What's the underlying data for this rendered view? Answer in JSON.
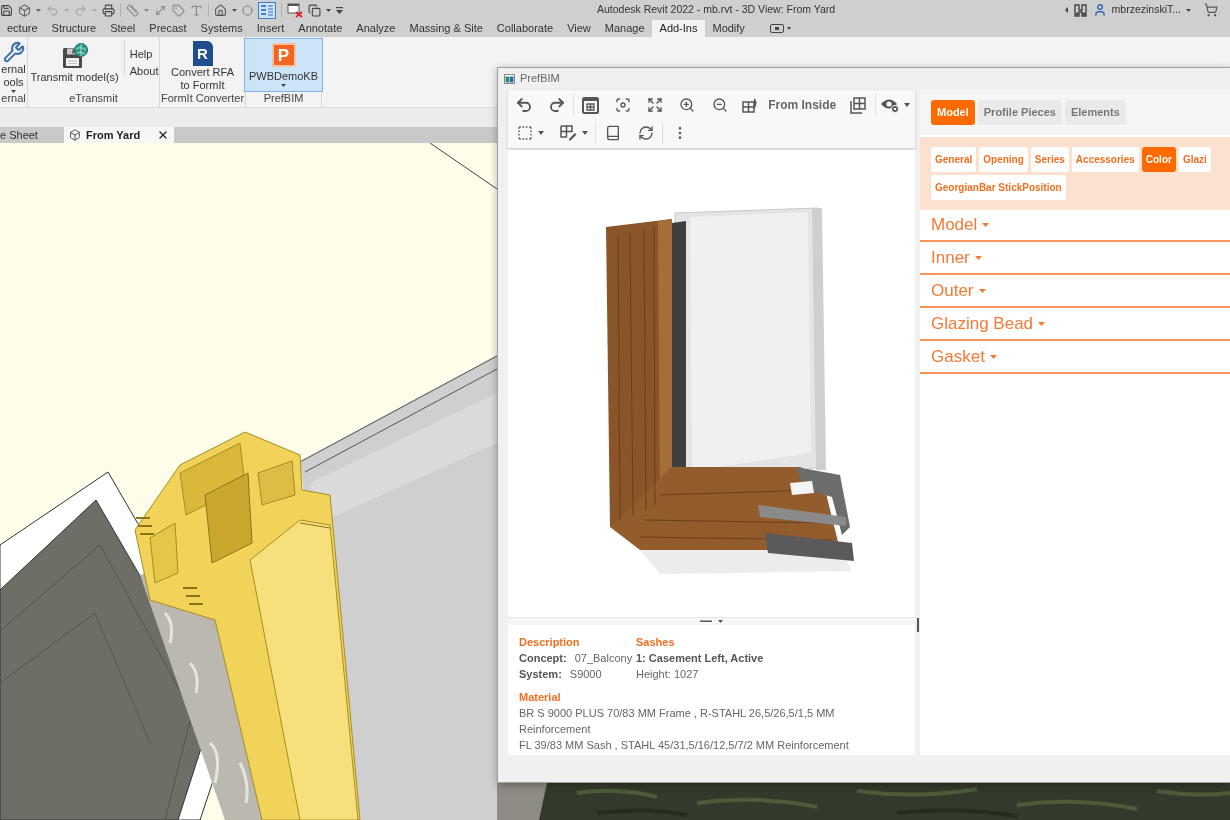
{
  "window": {
    "title": "Autodesk Revit 2022 - mb.rvt - 3D View: From Yard"
  },
  "quick_access_toolbar": {
    "undo": {
      "disabled": true
    },
    "redo": {
      "disabled": true
    },
    "thin_lines": {
      "on": true
    }
  },
  "account": {
    "user_name": "mbrzezinskiT..."
  },
  "ribbon_tabs": [
    {
      "label": "ecture",
      "selected": false
    },
    {
      "label": "Structure",
      "selected": false
    },
    {
      "label": "Steel",
      "selected": false
    },
    {
      "label": "Precast",
      "selected": false
    },
    {
      "label": "Systems",
      "selected": false
    },
    {
      "label": "Insert",
      "selected": false
    },
    {
      "label": "Annotate",
      "selected": false
    },
    {
      "label": "Analyze",
      "selected": false
    },
    {
      "label": "Massing & Site",
      "selected": false
    },
    {
      "label": "Collaborate",
      "selected": false
    },
    {
      "label": "View",
      "selected": false
    },
    {
      "label": "Manage",
      "selected": false
    },
    {
      "label": "Add-Ins",
      "selected": true
    },
    {
      "label": "Modify",
      "selected": false
    }
  ],
  "ribbon_panels": [
    {
      "label": "ernal",
      "items": [
        {
          "kind": "large",
          "lines": [
            "ernal",
            "ools"
          ],
          "dropdown": true,
          "selected": false
        }
      ]
    },
    {
      "label": "eTransmit",
      "items": [
        {
          "kind": "large",
          "lines": [
            "Transmit model(s)"
          ],
          "dropdown": false,
          "selected": false
        },
        {
          "kind": "stack",
          "lines": [
            "Help",
            "About"
          ],
          "selected": false
        }
      ]
    },
    {
      "label": "FormIt Converter",
      "items": [
        {
          "kind": "large",
          "icon_text": "R",
          "lines": [
            "Convert RFA",
            "to FormIt"
          ],
          "dropdown": false,
          "selected": false
        }
      ]
    },
    {
      "label": "PrefBIM",
      "items": [
        {
          "kind": "large",
          "icon_text": "P",
          "lines": [
            "PWBDemoKB"
          ],
          "dropdown": true,
          "selected": true
        }
      ]
    }
  ],
  "view_tabs": [
    {
      "label": "e Sheet",
      "selected": false
    },
    {
      "label": "From Yard",
      "selected": true
    }
  ],
  "prefbim": {
    "title": "PrefBIM",
    "viewer_toolbar": {
      "view_mode_label": "From Inside"
    },
    "description": {
      "heading": "Description",
      "fields": [
        {
          "label": "Concept:",
          "value": "07_Balcony"
        },
        {
          "label": "System:",
          "value": "S9000"
        }
      ]
    },
    "sashes": {
      "heading": "Sashes",
      "title": "1: Casement Left, Active",
      "details": [
        "Height: 1027"
      ]
    },
    "material": {
      "heading": "Material",
      "lines": [
        "BR S 9000 PLUS 70/83 MM Frame , R-STAHL 26,5/26,5/1,5 MM Reinforcement",
        "FL 39/83 MM Sash , STAHL 45/31,5/16/12,5/7/2 MM Reinforcement"
      ]
    },
    "main_tabs": [
      {
        "label": "Model",
        "selected": true
      },
      {
        "label": "Profile Pieces",
        "selected": false
      },
      {
        "label": "Elements",
        "selected": false
      }
    ],
    "category_tabs": [
      {
        "label": "General",
        "selected": false
      },
      {
        "label": "Opening",
        "selected": false
      },
      {
        "label": "Series",
        "selected": false
      },
      {
        "label": "Accessories",
        "selected": false
      },
      {
        "label": "Color",
        "selected": true
      },
      {
        "label": "Glazi",
        "selected": false
      },
      {
        "label": "GeorgianBar StickPosition",
        "selected": false
      }
    ],
    "sections": [
      "Model",
      "Inner",
      "Outer",
      "Glazing Bead",
      "Gasket"
    ]
  }
}
